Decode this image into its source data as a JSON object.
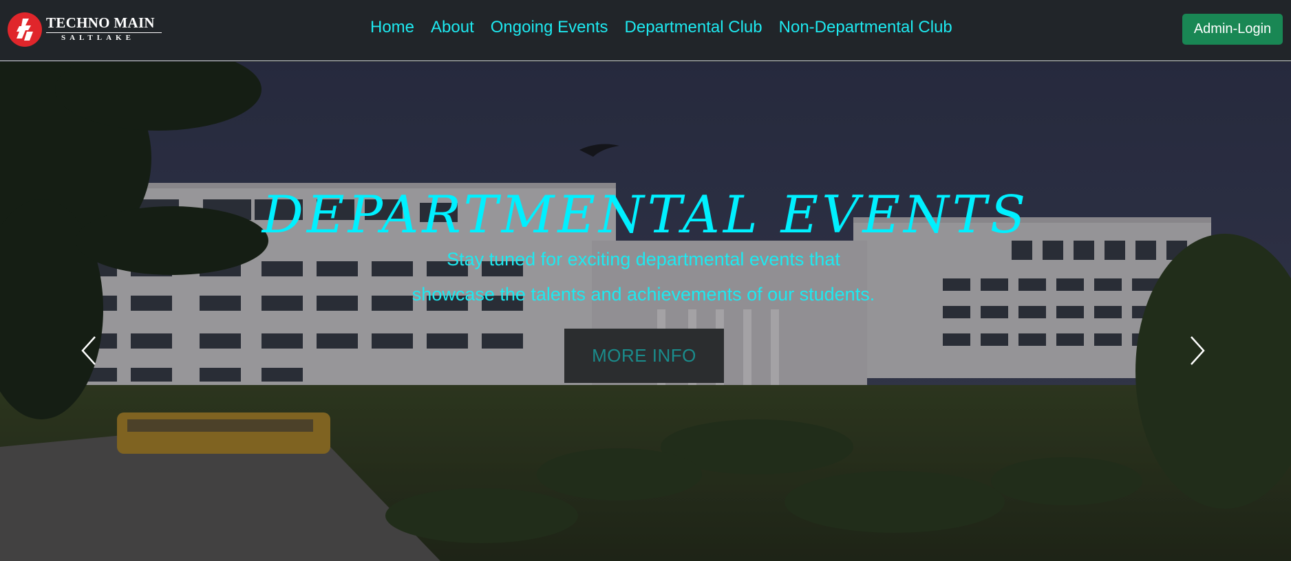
{
  "brand": {
    "name": "TECHNO MAIN",
    "sub": "SALTLAKE",
    "logo_icon": "techno-india-logo-icon"
  },
  "nav": {
    "items": [
      {
        "label": "Home"
      },
      {
        "label": "About"
      },
      {
        "label": "Ongoing Events"
      },
      {
        "label": "Departmental Club"
      },
      {
        "label": "Non-Departmental Club"
      }
    ],
    "admin_label": "Admin-Login"
  },
  "hero": {
    "title": "DEPARTMENTAL EVENTS",
    "text_line1": "Stay tuned for exciting departmental events that",
    "text_line2": "showcase the talents and achievements of our students.",
    "button_label": "MORE INFO",
    "prev_icon": "chevron-left-icon",
    "next_icon": "chevron-right-icon"
  },
  "colors": {
    "nav_bg": "#212529",
    "link": "#1ee9f0",
    "title": "#00f0ff",
    "admin_btn": "#198754",
    "more_btn_bg": "#2b2d2f",
    "more_btn_text": "#1a8c8c"
  }
}
